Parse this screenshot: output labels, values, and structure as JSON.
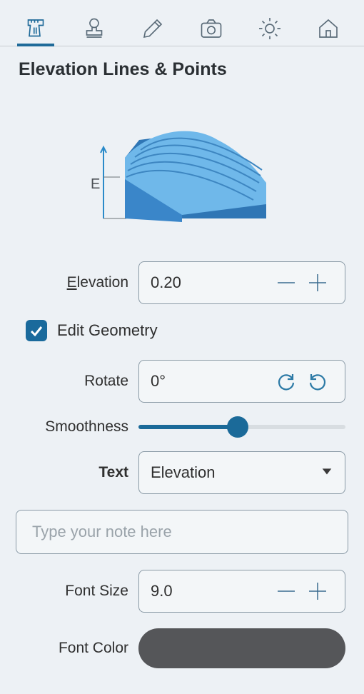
{
  "panel": {
    "title": "Elevation Lines & Points"
  },
  "tabs": [
    "ruler",
    "stamp",
    "pencil",
    "camera",
    "brightness",
    "home"
  ],
  "active_tab": 0,
  "elevation": {
    "label_prefix": "E",
    "label_rest": "levation",
    "value": "0.20"
  },
  "edit_geometry": {
    "label": "Edit Geometry",
    "checked": true
  },
  "rotate": {
    "label": "Rotate",
    "value": "0°"
  },
  "smoothness": {
    "label": "Smoothness",
    "percent": 48
  },
  "text_select": {
    "label": "Text",
    "value": "Elevation"
  },
  "note": {
    "placeholder": "Type your note here",
    "value": ""
  },
  "font_size": {
    "label": "Font Size",
    "value": "9.0"
  },
  "font_color": {
    "label": "Font Color",
    "hex": "#555659"
  },
  "preview_axis_label": "E"
}
